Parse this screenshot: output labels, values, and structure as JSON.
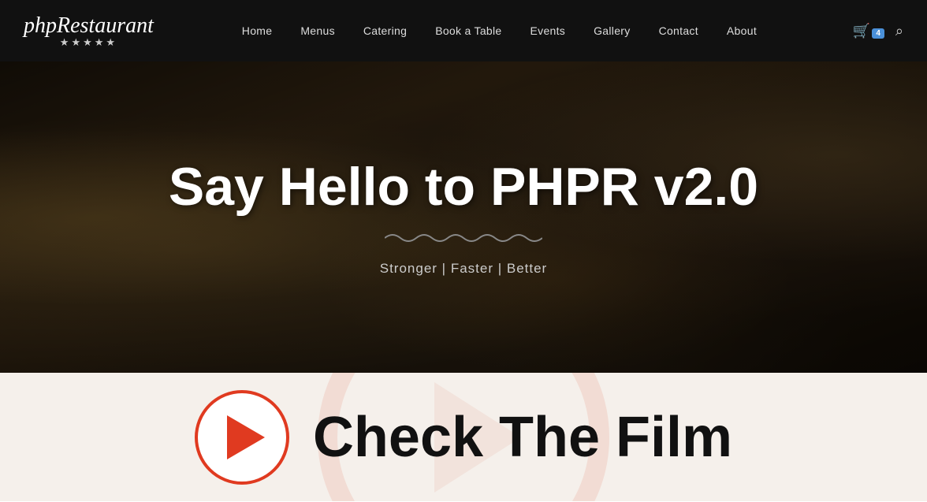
{
  "header": {
    "logo_text": "phpRestaurant",
    "logo_stars": "★★★★★",
    "nav": {
      "items": [
        {
          "label": "Home",
          "id": "home"
        },
        {
          "label": "Menus",
          "id": "menus"
        },
        {
          "label": "Catering",
          "id": "catering"
        },
        {
          "label": "Book a Table",
          "id": "book-table"
        },
        {
          "label": "Events",
          "id": "events"
        },
        {
          "label": "Gallery",
          "id": "gallery"
        },
        {
          "label": "Contact",
          "id": "contact"
        },
        {
          "label": "About",
          "id": "about"
        }
      ],
      "cart_badge": "4"
    }
  },
  "hero": {
    "title": "Say Hello to PHPR v2.0",
    "squiggle": "∿∿∿∿∿∿∿∿∿∿∿∿",
    "subtitle": "Stronger | Faster | Better"
  },
  "cta": {
    "text": "Check The Film",
    "play_label": "Play"
  }
}
